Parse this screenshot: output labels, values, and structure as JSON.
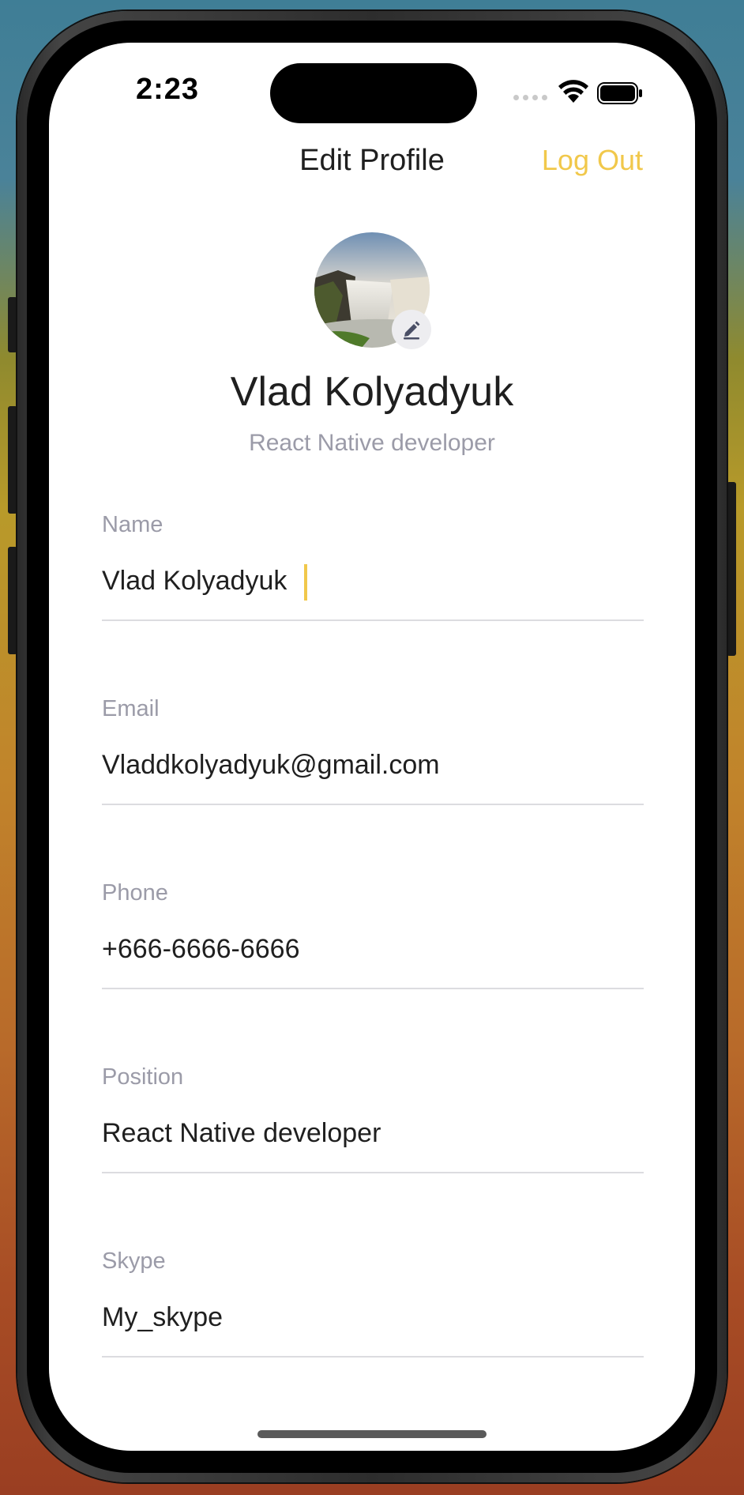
{
  "status_bar": {
    "time": "2:23"
  },
  "header": {
    "title": "Edit Profile",
    "logout_label": "Log Out",
    "accent_color": "#f1c84b"
  },
  "profile": {
    "name": "Vlad Kolyadyuk",
    "role": "React Native developer",
    "avatar_icon": "waterfall-photo",
    "edit_icon": "pencil-icon"
  },
  "form": {
    "fields": [
      {
        "label": "Name",
        "value": "Vlad Kolyadyuk"
      },
      {
        "label": "Email",
        "value": "Vladdkolyadyuk@gmail.com"
      },
      {
        "label": "Phone",
        "value": "+666-6666-6666"
      },
      {
        "label": "Position",
        "value": "React Native developer"
      },
      {
        "label": "Skype",
        "value": "My_skype"
      }
    ]
  }
}
